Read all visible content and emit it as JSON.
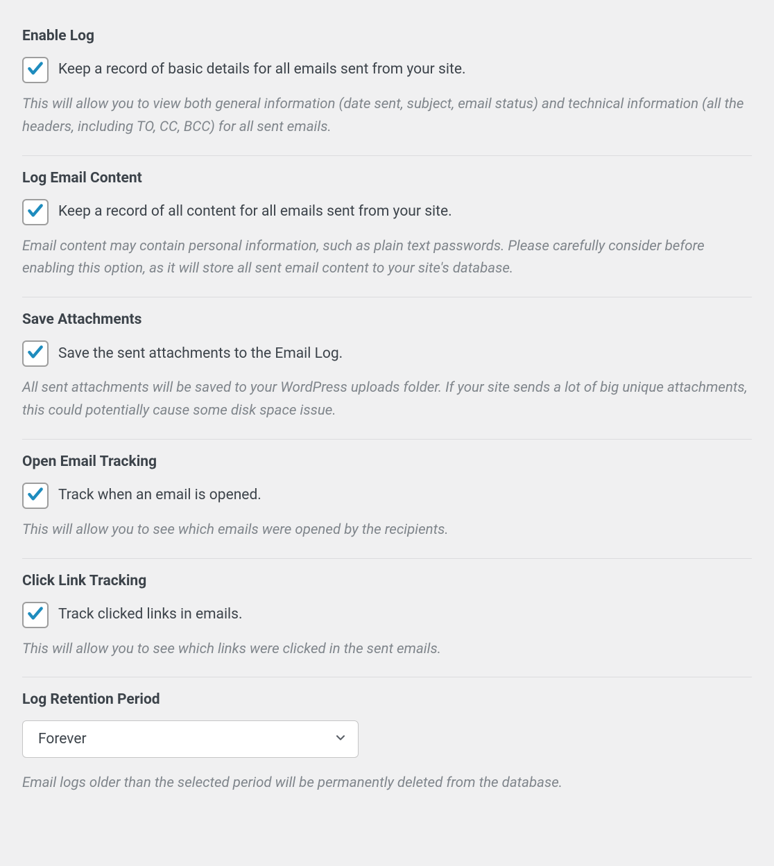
{
  "colors": {
    "accent": "#1e8cbe"
  },
  "sections": {
    "enable_log": {
      "title": "Enable Log",
      "checkbox_label": "Keep a record of basic details for all emails sent from your site.",
      "description": "This will allow you to view both general information (date sent, subject, email status) and technical information (all the headers, including TO, CC, BCC) for all sent emails.",
      "checked": true
    },
    "log_email_content": {
      "title": "Log Email Content",
      "checkbox_label": "Keep a record of all content for all emails sent from your site.",
      "description": "Email content may contain personal information, such as plain text passwords. Please carefully consider before enabling this option, as it will store all sent email content to your site's database.",
      "checked": true
    },
    "save_attachments": {
      "title": "Save Attachments",
      "checkbox_label": "Save the sent attachments to the Email Log.",
      "description": "All sent attachments will be saved to your WordPress uploads folder. If your site sends a lot of big unique attachments, this could potentially cause some disk space issue.",
      "checked": true
    },
    "open_email_tracking": {
      "title": "Open Email Tracking",
      "checkbox_label": "Track when an email is opened.",
      "description": "This will allow you to see which emails were opened by the recipients.",
      "checked": true
    },
    "click_link_tracking": {
      "title": "Click Link Tracking",
      "checkbox_label": "Track clicked links in emails.",
      "description": "This will allow you to see which links were clicked in the sent emails.",
      "checked": true
    },
    "log_retention_period": {
      "title": "Log Retention Period",
      "select_value": "Forever",
      "description": "Email logs older than the selected period will be permanently deleted from the database."
    }
  }
}
